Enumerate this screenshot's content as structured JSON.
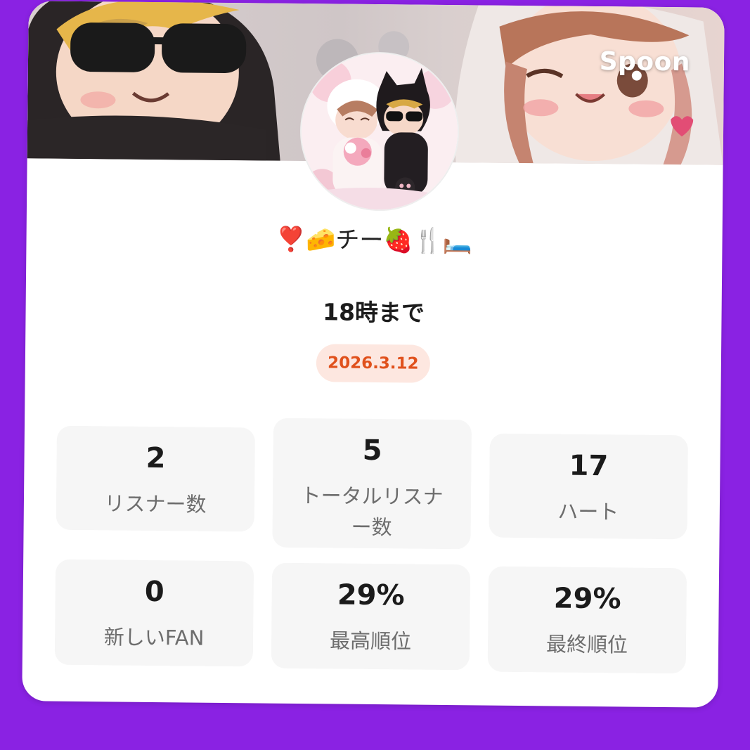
{
  "brand": "Spoon",
  "profile": {
    "title": "❣️🧀チー🍓🍴🛏️",
    "subtitle": "18時まで",
    "date": "2026.3.12"
  },
  "stats": [
    {
      "value": "2",
      "label": "リスナー数"
    },
    {
      "value": "5",
      "label": "トータルリスナー数"
    },
    {
      "value": "17",
      "label": "ハート"
    },
    {
      "value": "0",
      "label": "新しいFAN"
    },
    {
      "value": "29%",
      "label": "最高順位"
    },
    {
      "value": "29%",
      "label": "最終順位"
    }
  ],
  "colors": {
    "background": "#8a22e3",
    "card": "#ffffff",
    "date_badge_bg": "#fde7e0",
    "date_badge_text": "#e0511c",
    "stat_bg": "#f6f6f6"
  }
}
